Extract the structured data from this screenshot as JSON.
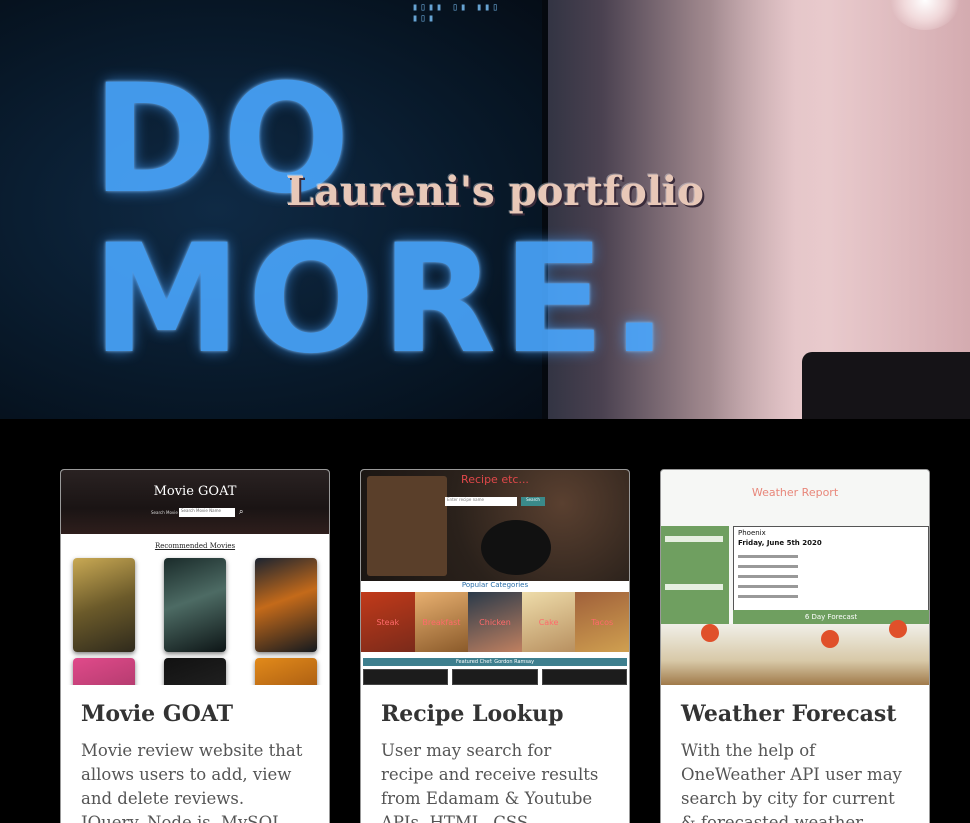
{
  "hero": {
    "title": "Laureni's portfolio",
    "background_text": [
      "DO",
      "MORE."
    ]
  },
  "projects": [
    {
      "title": "Movie GOAT",
      "description": "Movie review website that allows users to add, view and delete reviews. JQuery, Node.js, MySQL...",
      "thumbnail": {
        "header": "Movie GOAT",
        "search_label": "Search Movie",
        "search_placeholder": "Search Movie Name",
        "section_label": "Recommended Movies"
      }
    },
    {
      "title": "Recipe Lookup",
      "description": "User may search for recipe and receive results from Edamam & Youtube APIs. HTML, CSS, JavaScript...",
      "thumbnail": {
        "header": "Recipe etc...",
        "search_placeholder": "Enter recipe name",
        "search_button": "Search",
        "section_label": "Popular Categories",
        "categories": [
          "Steak",
          "Breakfast",
          "Chicken",
          "Cake",
          "Tacos"
        ],
        "featured_label": "Featured Chef: Gordon Ramsay"
      }
    },
    {
      "title": "Weather Forecast",
      "description": "With the help of OneWeather API user may search by city for current & forecasted weather report...",
      "thumbnail": {
        "header": "Weather Report",
        "city": "Phoenix",
        "date": "Friday, June 5th 2020",
        "forecast_label": "6 Day Forecast"
      }
    }
  ],
  "colors": {
    "page_background": "#000000",
    "card_background": "#ffffff",
    "hero_title": "#e8c8b8",
    "weather_green": "#6f9f60",
    "recipe_red": "#e0484a"
  }
}
